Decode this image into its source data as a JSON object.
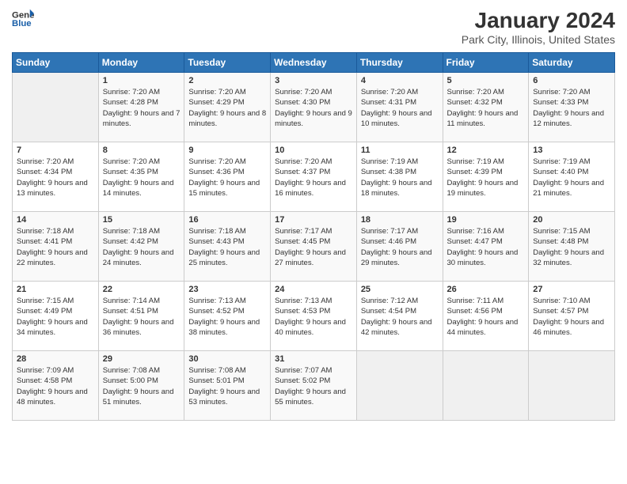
{
  "header": {
    "logo": {
      "line1": "General",
      "line2": "Blue"
    },
    "title": "January 2024",
    "subtitle": "Park City, Illinois, United States"
  },
  "weekdays": [
    "Sunday",
    "Monday",
    "Tuesday",
    "Wednesday",
    "Thursday",
    "Friday",
    "Saturday"
  ],
  "weeks": [
    [
      {
        "day": "",
        "sunrise": "",
        "sunset": "",
        "daylight": ""
      },
      {
        "day": "1",
        "sunrise": "Sunrise: 7:20 AM",
        "sunset": "Sunset: 4:28 PM",
        "daylight": "Daylight: 9 hours and 7 minutes."
      },
      {
        "day": "2",
        "sunrise": "Sunrise: 7:20 AM",
        "sunset": "Sunset: 4:29 PM",
        "daylight": "Daylight: 9 hours and 8 minutes."
      },
      {
        "day": "3",
        "sunrise": "Sunrise: 7:20 AM",
        "sunset": "Sunset: 4:30 PM",
        "daylight": "Daylight: 9 hours and 9 minutes."
      },
      {
        "day": "4",
        "sunrise": "Sunrise: 7:20 AM",
        "sunset": "Sunset: 4:31 PM",
        "daylight": "Daylight: 9 hours and 10 minutes."
      },
      {
        "day": "5",
        "sunrise": "Sunrise: 7:20 AM",
        "sunset": "Sunset: 4:32 PM",
        "daylight": "Daylight: 9 hours and 11 minutes."
      },
      {
        "day": "6",
        "sunrise": "Sunrise: 7:20 AM",
        "sunset": "Sunset: 4:33 PM",
        "daylight": "Daylight: 9 hours and 12 minutes."
      }
    ],
    [
      {
        "day": "7",
        "sunrise": "Sunrise: 7:20 AM",
        "sunset": "Sunset: 4:34 PM",
        "daylight": "Daylight: 9 hours and 13 minutes."
      },
      {
        "day": "8",
        "sunrise": "Sunrise: 7:20 AM",
        "sunset": "Sunset: 4:35 PM",
        "daylight": "Daylight: 9 hours and 14 minutes."
      },
      {
        "day": "9",
        "sunrise": "Sunrise: 7:20 AM",
        "sunset": "Sunset: 4:36 PM",
        "daylight": "Daylight: 9 hours and 15 minutes."
      },
      {
        "day": "10",
        "sunrise": "Sunrise: 7:20 AM",
        "sunset": "Sunset: 4:37 PM",
        "daylight": "Daylight: 9 hours and 16 minutes."
      },
      {
        "day": "11",
        "sunrise": "Sunrise: 7:19 AM",
        "sunset": "Sunset: 4:38 PM",
        "daylight": "Daylight: 9 hours and 18 minutes."
      },
      {
        "day": "12",
        "sunrise": "Sunrise: 7:19 AM",
        "sunset": "Sunset: 4:39 PM",
        "daylight": "Daylight: 9 hours and 19 minutes."
      },
      {
        "day": "13",
        "sunrise": "Sunrise: 7:19 AM",
        "sunset": "Sunset: 4:40 PM",
        "daylight": "Daylight: 9 hours and 21 minutes."
      }
    ],
    [
      {
        "day": "14",
        "sunrise": "Sunrise: 7:18 AM",
        "sunset": "Sunset: 4:41 PM",
        "daylight": "Daylight: 9 hours and 22 minutes."
      },
      {
        "day": "15",
        "sunrise": "Sunrise: 7:18 AM",
        "sunset": "Sunset: 4:42 PM",
        "daylight": "Daylight: 9 hours and 24 minutes."
      },
      {
        "day": "16",
        "sunrise": "Sunrise: 7:18 AM",
        "sunset": "Sunset: 4:43 PM",
        "daylight": "Daylight: 9 hours and 25 minutes."
      },
      {
        "day": "17",
        "sunrise": "Sunrise: 7:17 AM",
        "sunset": "Sunset: 4:45 PM",
        "daylight": "Daylight: 9 hours and 27 minutes."
      },
      {
        "day": "18",
        "sunrise": "Sunrise: 7:17 AM",
        "sunset": "Sunset: 4:46 PM",
        "daylight": "Daylight: 9 hours and 29 minutes."
      },
      {
        "day": "19",
        "sunrise": "Sunrise: 7:16 AM",
        "sunset": "Sunset: 4:47 PM",
        "daylight": "Daylight: 9 hours and 30 minutes."
      },
      {
        "day": "20",
        "sunrise": "Sunrise: 7:15 AM",
        "sunset": "Sunset: 4:48 PM",
        "daylight": "Daylight: 9 hours and 32 minutes."
      }
    ],
    [
      {
        "day": "21",
        "sunrise": "Sunrise: 7:15 AM",
        "sunset": "Sunset: 4:49 PM",
        "daylight": "Daylight: 9 hours and 34 minutes."
      },
      {
        "day": "22",
        "sunrise": "Sunrise: 7:14 AM",
        "sunset": "Sunset: 4:51 PM",
        "daylight": "Daylight: 9 hours and 36 minutes."
      },
      {
        "day": "23",
        "sunrise": "Sunrise: 7:13 AM",
        "sunset": "Sunset: 4:52 PM",
        "daylight": "Daylight: 9 hours and 38 minutes."
      },
      {
        "day": "24",
        "sunrise": "Sunrise: 7:13 AM",
        "sunset": "Sunset: 4:53 PM",
        "daylight": "Daylight: 9 hours and 40 minutes."
      },
      {
        "day": "25",
        "sunrise": "Sunrise: 7:12 AM",
        "sunset": "Sunset: 4:54 PM",
        "daylight": "Daylight: 9 hours and 42 minutes."
      },
      {
        "day": "26",
        "sunrise": "Sunrise: 7:11 AM",
        "sunset": "Sunset: 4:56 PM",
        "daylight": "Daylight: 9 hours and 44 minutes."
      },
      {
        "day": "27",
        "sunrise": "Sunrise: 7:10 AM",
        "sunset": "Sunset: 4:57 PM",
        "daylight": "Daylight: 9 hours and 46 minutes."
      }
    ],
    [
      {
        "day": "28",
        "sunrise": "Sunrise: 7:09 AM",
        "sunset": "Sunset: 4:58 PM",
        "daylight": "Daylight: 9 hours and 48 minutes."
      },
      {
        "day": "29",
        "sunrise": "Sunrise: 7:08 AM",
        "sunset": "Sunset: 5:00 PM",
        "daylight": "Daylight: 9 hours and 51 minutes."
      },
      {
        "day": "30",
        "sunrise": "Sunrise: 7:08 AM",
        "sunset": "Sunset: 5:01 PM",
        "daylight": "Daylight: 9 hours and 53 minutes."
      },
      {
        "day": "31",
        "sunrise": "Sunrise: 7:07 AM",
        "sunset": "Sunset: 5:02 PM",
        "daylight": "Daylight: 9 hours and 55 minutes."
      },
      {
        "day": "",
        "sunrise": "",
        "sunset": "",
        "daylight": ""
      },
      {
        "day": "",
        "sunrise": "",
        "sunset": "",
        "daylight": ""
      },
      {
        "day": "",
        "sunrise": "",
        "sunset": "",
        "daylight": ""
      }
    ]
  ]
}
